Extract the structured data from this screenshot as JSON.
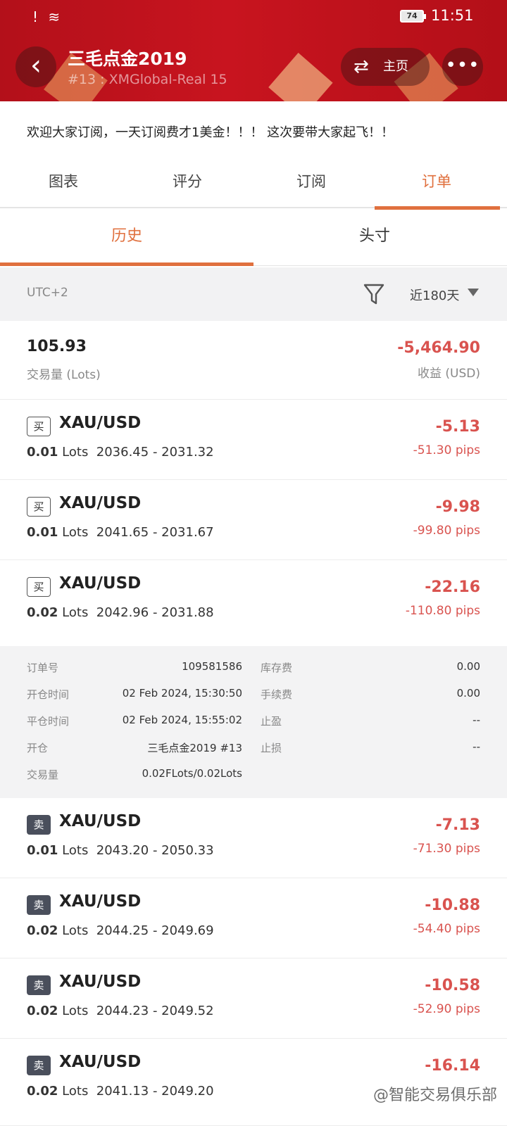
{
  "status_bar": {
    "left_icons": "! ≋",
    "battery": "74",
    "time": "11:51"
  },
  "header": {
    "title": "三毛点金2019",
    "subtitle": "#13 : XMGlobal-Real 15",
    "home_label": "主页",
    "more_label": "•••",
    "theme_color": "#c8141f"
  },
  "description": "欢迎大家订阅，一天订阅费才1美金！！！ 这次要带大家起飞！！",
  "main_tabs": [
    "图表",
    "评分",
    "订阅",
    "订单"
  ],
  "main_tab_active": "订单",
  "sub_tabs": [
    "历史",
    "头寸"
  ],
  "sub_tab_active": "历史",
  "filter": {
    "timezone": "UTC+2",
    "range": "近180天"
  },
  "summary": {
    "volume": "105.93",
    "volume_label": "交易量 (Lots)",
    "profit": "-5,464.90",
    "profit_label": "收益 (USD)"
  },
  "orders": [
    {
      "side": "买",
      "type": "buy",
      "symbol": "XAU/USD",
      "lots": "0.01",
      "lots_unit": "Lots",
      "prices": "2036.45 - 2031.32",
      "profit": "-5.13",
      "pips": "-51.30 pips"
    },
    {
      "side": "买",
      "type": "buy",
      "symbol": "XAU/USD",
      "lots": "0.01",
      "lots_unit": "Lots",
      "prices": "2041.65 - 2031.67",
      "profit": "-9.98",
      "pips": "-99.80 pips"
    },
    {
      "side": "买",
      "type": "buy",
      "symbol": "XAU/USD",
      "lots": "0.02",
      "lots_unit": "Lots",
      "prices": "2042.96 - 2031.88",
      "profit": "-22.16",
      "pips": "-110.80 pips"
    },
    {
      "side": "卖",
      "type": "sell",
      "symbol": "XAU/USD",
      "lots": "0.01",
      "lots_unit": "Lots",
      "prices": "2043.20 - 2050.33",
      "profit": "-7.13",
      "pips": "-71.30 pips"
    },
    {
      "side": "卖",
      "type": "sell",
      "symbol": "XAU/USD",
      "lots": "0.02",
      "lots_unit": "Lots",
      "prices": "2044.25 - 2049.69",
      "profit": "-10.88",
      "pips": "-54.40 pips"
    },
    {
      "side": "卖",
      "type": "sell",
      "symbol": "XAU/USD",
      "lots": "0.02",
      "lots_unit": "Lots",
      "prices": "2044.23 - 2049.52",
      "profit": "-10.58",
      "pips": "-52.90 pips"
    },
    {
      "side": "卖",
      "type": "sell",
      "symbol": "XAU/USD",
      "lots": "0.02",
      "lots_unit": "Lots",
      "prices": "2041.13 - 2049.20",
      "profit": "-16.14",
      "pips": ""
    }
  ],
  "order_detail": {
    "order_no_label": "订单号",
    "order_no": "109581586",
    "open_time_label": "开仓时间",
    "open_time": "02 Feb 2024, 15:30:50",
    "close_time_label": "平仓时间",
    "close_time": "02 Feb 2024, 15:55:02",
    "open_label": "开仓",
    "open_value": "三毛点金2019  #13",
    "volume_label": "交易量",
    "volume_value": "0.02FLots/0.02Lots",
    "swap_label": "库存费",
    "swap": "0.00",
    "commission_label": "手续费",
    "commission": "0.00",
    "tp_label": "止盈",
    "tp": "--",
    "sl_label": "止损",
    "sl": "--"
  },
  "watermark": "@智能交易俱乐部",
  "colors": {
    "accent": "#e0703e",
    "loss": "#d9534f",
    "sell_tag": "#4a4f5c"
  }
}
